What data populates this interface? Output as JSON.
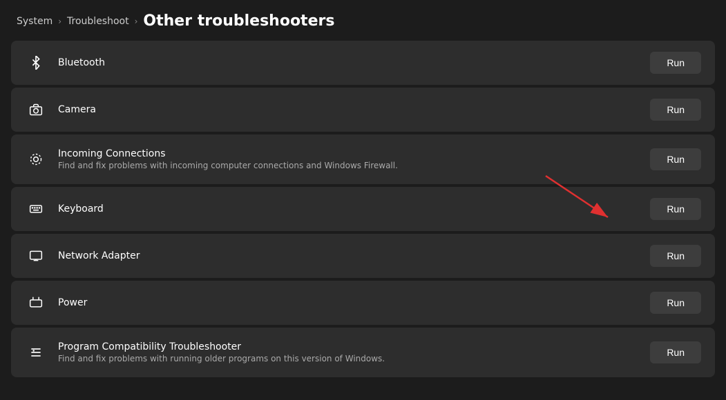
{
  "breadcrumb": {
    "system_label": "System",
    "troubleshoot_label": "Troubleshoot",
    "current_label": "Other troubleshooters"
  },
  "items": [
    {
      "id": "bluetooth",
      "icon": "bluetooth",
      "title": "Bluetooth",
      "desc": "",
      "run_label": "Run"
    },
    {
      "id": "camera",
      "icon": "camera",
      "title": "Camera",
      "desc": "",
      "run_label": "Run"
    },
    {
      "id": "incoming-connections",
      "icon": "incoming",
      "title": "Incoming Connections",
      "desc": "Find and fix problems with incoming computer connections and Windows Firewall.",
      "run_label": "Run"
    },
    {
      "id": "keyboard",
      "icon": "keyboard",
      "title": "Keyboard",
      "desc": "",
      "run_label": "Run"
    },
    {
      "id": "network-adapter",
      "icon": "network",
      "title": "Network Adapter",
      "desc": "",
      "run_label": "Run"
    },
    {
      "id": "power",
      "icon": "power",
      "title": "Power",
      "desc": "",
      "run_label": "Run"
    },
    {
      "id": "program-compatibility",
      "icon": "program",
      "title": "Program Compatibility Troubleshooter",
      "desc": "Find and fix problems with running older programs on this version of Windows.",
      "run_label": "Run"
    }
  ]
}
